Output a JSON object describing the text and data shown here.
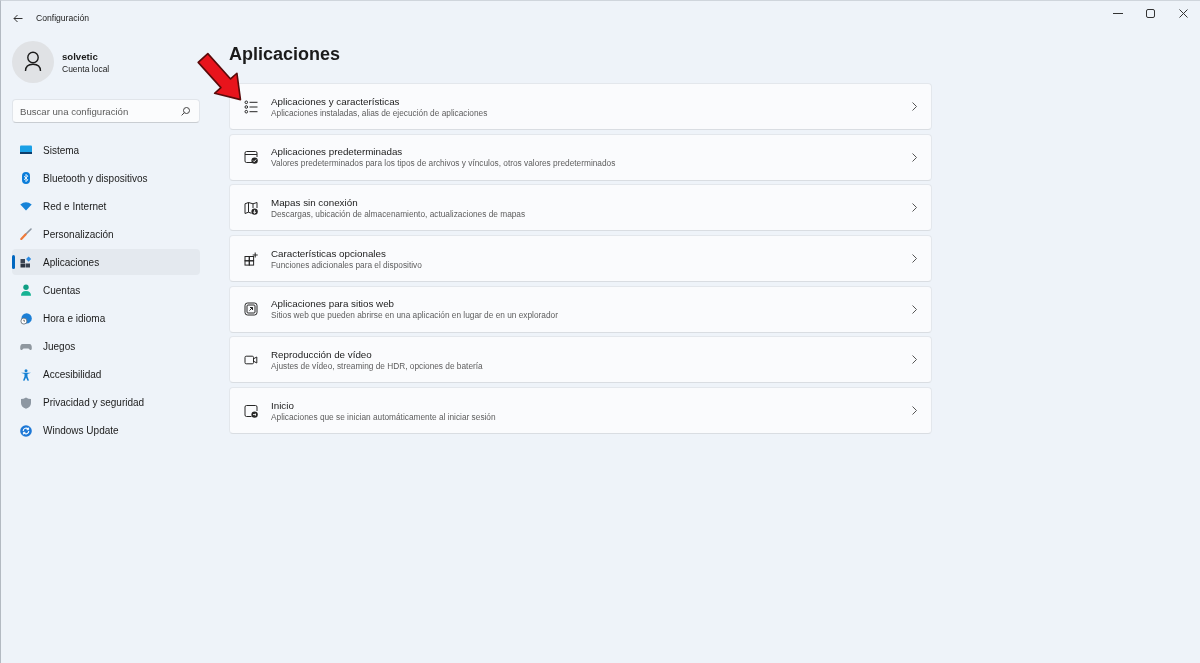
{
  "window": {
    "title": "Configuración"
  },
  "account": {
    "name": "solvetic",
    "account_type": "Cuenta local"
  },
  "search": {
    "placeholder": "Buscar una configuración"
  },
  "sidebar": {
    "items": [
      {
        "label": "Sistema",
        "selected": false
      },
      {
        "label": "Bluetooth y dispositivos",
        "selected": false
      },
      {
        "label": "Red e Internet",
        "selected": false
      },
      {
        "label": "Personalización",
        "selected": false
      },
      {
        "label": "Aplicaciones",
        "selected": true
      },
      {
        "label": "Cuentas",
        "selected": false
      },
      {
        "label": "Hora e idioma",
        "selected": false
      },
      {
        "label": "Juegos",
        "selected": false
      },
      {
        "label": "Accesibilidad",
        "selected": false
      },
      {
        "label": "Privacidad y seguridad",
        "selected": false
      },
      {
        "label": "Windows Update",
        "selected": false
      }
    ]
  },
  "page": {
    "title": "Aplicaciones",
    "cards": [
      {
        "title": "Aplicaciones y características",
        "description": "Aplicaciones instaladas, alias de ejecución de aplicaciones"
      },
      {
        "title": "Aplicaciones predeterminadas",
        "description": "Valores predeterminados para los tipos de archivos y vínculos, otros valores predeterminados"
      },
      {
        "title": "Mapas sin conexión",
        "description": "Descargas, ubicación de almacenamiento, actualizaciones de mapas"
      },
      {
        "title": "Características opcionales",
        "description": "Funciones adicionales para el dispositivo"
      },
      {
        "title": "Aplicaciones para sitios web",
        "description": "Sitios web que pueden abrirse en una aplicación en lugar de en un explorador"
      },
      {
        "title": "Reproducción de vídeo",
        "description": "Ajustes de vídeo, streaming de HDR, opciones de batería"
      },
      {
        "title": "Inicio",
        "description": "Aplicaciones que se inician automáticamente al iniciar sesión"
      }
    ]
  }
}
